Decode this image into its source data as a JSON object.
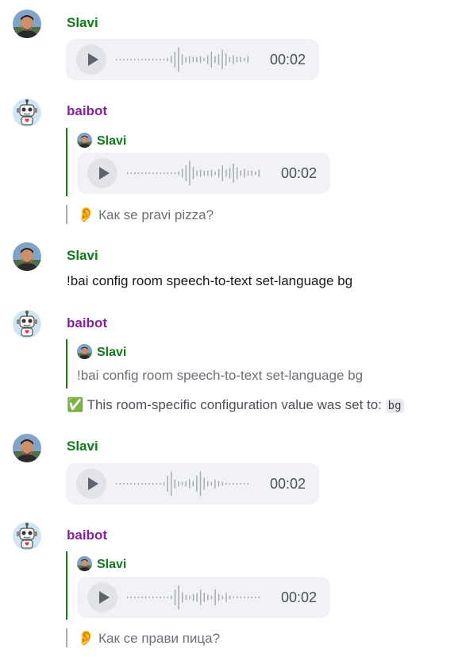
{
  "messages": [
    {
      "sender": "Slavi",
      "type": "voice",
      "duration": "00:02"
    },
    {
      "sender": "baibot",
      "reply_to": "Slavi",
      "reply_duration": "00:02",
      "transcript": "Как se pravi pizza?"
    },
    {
      "sender": "Slavi",
      "text": "!bai config room speech-to-text set-language bg"
    },
    {
      "sender": "baibot",
      "reply_to": "Slavi",
      "reply_text": "!bai config room speech-to-text set-language bg",
      "confirm": "✅ This room-specific configuration value was set to:",
      "confirm_code": "bg"
    },
    {
      "sender": "Slavi",
      "type": "voice",
      "duration": "00:02"
    },
    {
      "sender": "baibot",
      "reply_to": "Slavi",
      "reply_duration": "00:02",
      "transcript": "Как се прави пица?"
    }
  ],
  "icons": {
    "play": "play-icon",
    "ear": "👂"
  },
  "colors": {
    "slavi": "#0f7a1a",
    "baibot": "#8a1f9e",
    "voice_bg": "#f1f2f5"
  }
}
